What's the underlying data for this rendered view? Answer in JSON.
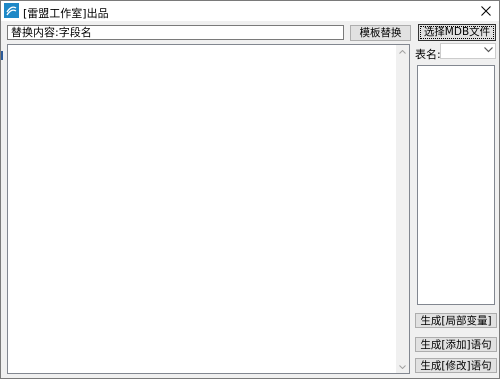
{
  "window": {
    "title": "[雷盟工作室]出品"
  },
  "replace": {
    "value": "替换内容:字段名"
  },
  "buttons": {
    "template_replace": "模板替换",
    "select_mdb": "选择MDB文件",
    "gen_local_var": "生成[局部变量]",
    "gen_insert": "生成[添加]语句",
    "gen_update": "生成[修改]语句"
  },
  "table": {
    "label": "表名:",
    "selected": ""
  },
  "output": {
    "text": ""
  },
  "icons": {
    "app": "app-icon",
    "close": "close-icon",
    "dropdown": "chevron-down-icon",
    "scroll_up": "scroll-up-arrow-icon",
    "scroll_down": "scroll-down-arrow-icon"
  },
  "colors": {
    "app_icon": "#1e88c7",
    "focus_border": "#333333",
    "edge_accent": "#2b5b9a"
  }
}
